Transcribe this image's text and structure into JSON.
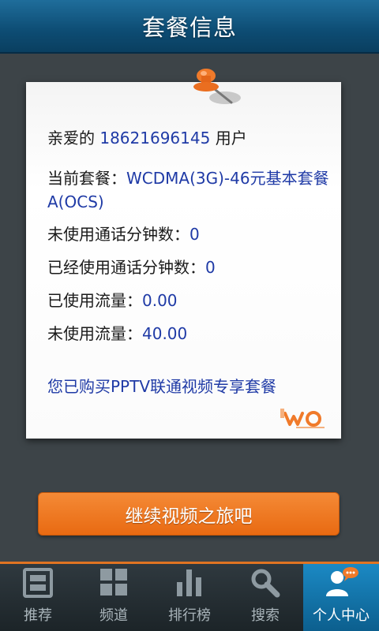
{
  "header": {
    "title": "套餐信息"
  },
  "card": {
    "greeting_prefix": "亲爱的",
    "phone": "18621696145",
    "greeting_suffix": "用户",
    "plan_label": "当前套餐：",
    "plan_value": "WCDMA(3G)-46元基本套餐A(OCS)",
    "unused_minutes_label": "未使用通话分钟数：",
    "unused_minutes_value": "0",
    "used_minutes_label": "已经使用通话分钟数：",
    "used_minutes_value": "0",
    "used_data_label": "已使用流量：",
    "used_data_value": "0.00",
    "unused_data_label": "未使用流量：",
    "unused_data_value": "40.00",
    "promo": "您已购买PPTV联通视频专享套餐",
    "logo_icon": "china-unicom-wo-logo"
  },
  "cta": {
    "label": "继续视频之旅吧"
  },
  "tabs": [
    {
      "label": "推荐",
      "icon": "recommend-icon",
      "active": false
    },
    {
      "label": "频道",
      "icon": "channel-grid-icon",
      "active": false
    },
    {
      "label": "排行榜",
      "icon": "ranking-bars-icon",
      "active": false
    },
    {
      "label": "搜索",
      "icon": "search-icon",
      "active": false
    },
    {
      "label": "个人中心",
      "icon": "user-center-icon",
      "active": true
    }
  ],
  "colors": {
    "accent": "#e96a12",
    "header": "#0d4c73",
    "value_blue": "#1f3aa6",
    "active_tab": "#1b89c4"
  }
}
